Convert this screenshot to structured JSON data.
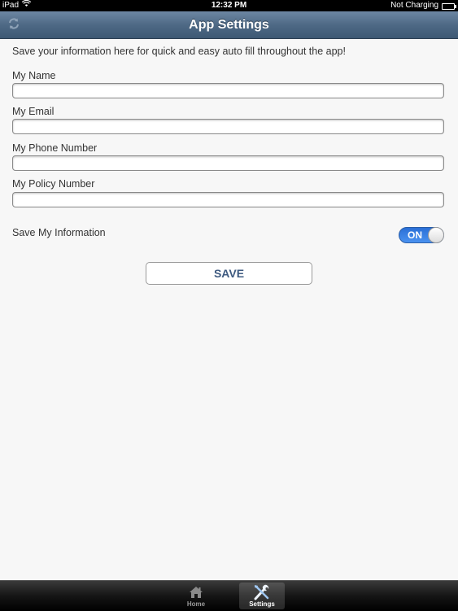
{
  "status_bar": {
    "device": "iPad",
    "time": "12:32 PM",
    "charging_status": "Not Charging"
  },
  "navbar": {
    "title": "App Settings"
  },
  "form": {
    "intro_text": "Save your information here for quick and easy auto fill throughout the app!",
    "fields": [
      {
        "label": "My Name",
        "value": "",
        "placeholder": ""
      },
      {
        "label": "My Email",
        "value": "",
        "placeholder": ""
      },
      {
        "label": "My Phone Number",
        "value": "",
        "placeholder": ""
      },
      {
        "label": "My Policy Number",
        "value": "",
        "placeholder": ""
      }
    ],
    "save_info": {
      "label": "Save My Information",
      "toggle_text": "ON",
      "on": true
    },
    "save_button": "SAVE"
  },
  "tab_bar": {
    "tabs": [
      {
        "label": "Home",
        "icon": "home-icon",
        "active": false
      },
      {
        "label": "Settings",
        "icon": "tools-icon",
        "active": true
      }
    ]
  },
  "colors": {
    "navbar": "#4e6985",
    "toggle_on": "#2a6fd6",
    "save_text": "#3e5a80",
    "background": "#f7f7f7"
  }
}
